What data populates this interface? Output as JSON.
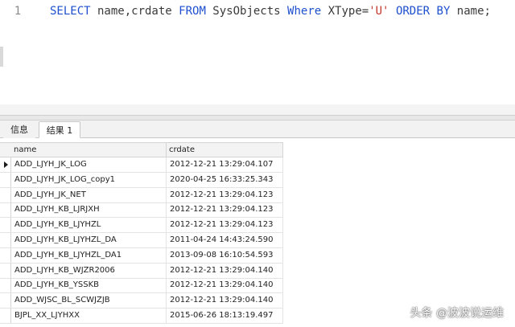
{
  "editor": {
    "line_number": "1",
    "query_parts": [
      {
        "text": "SELECT",
        "kind": "kw"
      },
      {
        "text": " name,crdate ",
        "kind": "plain"
      },
      {
        "text": "FROM",
        "kind": "kw"
      },
      {
        "text": " SysObjects ",
        "kind": "plain"
      },
      {
        "text": "Where",
        "kind": "kw"
      },
      {
        "text": " XType=",
        "kind": "plain"
      },
      {
        "text": "'U'",
        "kind": "str"
      },
      {
        "text": " ",
        "kind": "plain"
      },
      {
        "text": "ORDER BY",
        "kind": "kw"
      },
      {
        "text": " name;",
        "kind": "plain"
      }
    ]
  },
  "tabs": [
    {
      "label": "信息",
      "active": false
    },
    {
      "label": "结果 1",
      "active": true
    }
  ],
  "grid": {
    "columns": [
      "name",
      "crdate"
    ],
    "current_row": 0,
    "rows": [
      [
        "ADD_LJYH_JK_LOG",
        "2012-12-21 13:29:04.107"
      ],
      [
        "ADD_LJYH_JK_LOG_copy1",
        "2020-04-25 16:33:25.343"
      ],
      [
        "ADD_LJYH_JK_NET",
        "2012-12-21 13:29:04.123"
      ],
      [
        "ADD_LJYH_KB_LJRJXH",
        "2012-12-21 13:29:04.123"
      ],
      [
        "ADD_LJYH_KB_LJYHZL",
        "2012-12-21 13:29:04.123"
      ],
      [
        "ADD_LJYH_KB_LJYHZL_DA",
        "2011-04-24 14:43:24.590"
      ],
      [
        "ADD_LJYH_KB_LJYHZL_DA1",
        "2013-09-08 16:10:54.593"
      ],
      [
        "ADD_LJYH_KB_WJZR2006",
        "2012-12-21 13:29:04.140"
      ],
      [
        "ADD_LJYH_KB_YSSKB",
        "2012-12-21 13:29:04.140"
      ],
      [
        "ADD_WJSC_BL_SCWJZJB",
        "2012-12-21 13:29:04.140"
      ],
      [
        "BJPL_XX_LJYHXX",
        "2015-06-26 18:13:19.497"
      ]
    ]
  },
  "watermark": "头条 @波波说运维",
  "colors": {
    "keyword": "#1e4fcf",
    "string": "#c0392b"
  }
}
